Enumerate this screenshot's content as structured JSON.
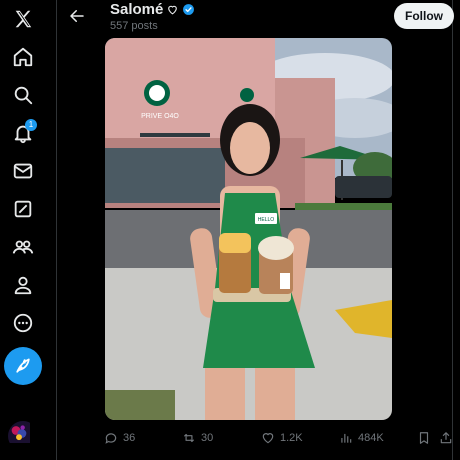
{
  "header": {
    "display_name": "Salomé",
    "post_count": "557 posts",
    "follow_label": "Follow"
  },
  "nav": {
    "notifications_badge": "1",
    "items": [
      "x-logo-icon",
      "home-icon",
      "search-icon",
      "bell-icon",
      "mail-icon",
      "grok-icon",
      "communities-icon",
      "profile-icon",
      "more-icon"
    ]
  },
  "media": {
    "storefront_sign": "PRIVE O4O",
    "apron_tag": "HELLO"
  },
  "actions": {
    "replies": "36",
    "reposts": "30",
    "likes": "1.2K",
    "views": "484K"
  },
  "colors": {
    "accent": "#1d9bf0",
    "background": "#000000",
    "muted": "#71767b"
  }
}
